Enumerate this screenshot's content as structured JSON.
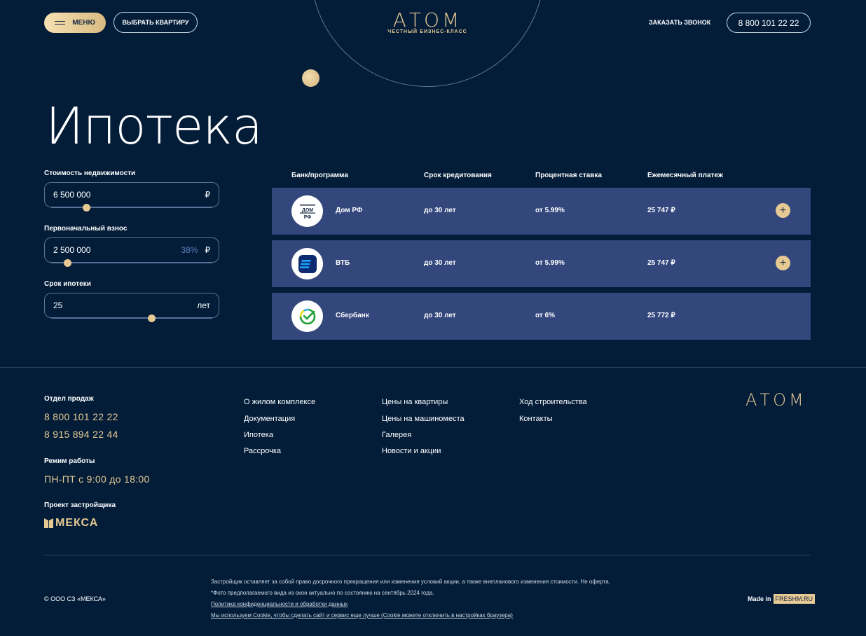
{
  "header": {
    "menu_label": "МЕНЮ",
    "choose_flat_label": "ВЫБРАТЬ КВАРТИРУ",
    "logo": "АТОМ",
    "logo_tagline": "ЧЕСТНЫЙ БИЗНЕС-КЛАСС",
    "call_label": "ЗАКАЗАТЬ ЗВОНОК",
    "phone": "8 800 101 22 22"
  },
  "page_title": "Ипотека",
  "calculator": {
    "price": {
      "label": "Стоимость недвижимости",
      "value": "6 500 000",
      "unit": "₽"
    },
    "down_payment": {
      "label": "Первоначальный взнос",
      "value": "2 500 000",
      "percent": "38%",
      "unit": "₽"
    },
    "term": {
      "label": "Срок ипотеки",
      "value": "25",
      "unit": "лет"
    }
  },
  "table": {
    "headers": [
      "Банк/программа",
      "Срок кредитования",
      "Процентная ставка",
      "Ежемесячный платеж"
    ],
    "rows": [
      {
        "bank": "Дом РФ",
        "logo_text": "ДОМ РФ",
        "term": "до 30 лет",
        "rate": "от 5.99%",
        "payment": "25 747 ₽",
        "expand": "+"
      },
      {
        "bank": "ВТБ",
        "term": "до 30 лет",
        "rate": "от 5.99%",
        "payment": "25 747 ₽",
        "expand": "+"
      },
      {
        "bank": "Сбербанк",
        "term": "до 30 лет",
        "rate": "от 6%",
        "payment": "25 772 ₽"
      }
    ]
  },
  "footer": {
    "sales_label": "Отдел продаж",
    "phones": [
      "8 800 101 22 22",
      "8 915 894 22 44"
    ],
    "hours_label": "Режим работы",
    "hours": "ПН-ПТ с 9:00 до 18:00",
    "developer_label": "Проект застройщика",
    "developer": "МЕКСА",
    "logo": "АТОМ",
    "nav_col1": [
      "О жилом комплексе",
      "Документация",
      "Ипотека",
      "Рассрочка"
    ],
    "nav_col2": [
      "Цены на квартиры",
      "Цены на машиноместа",
      "Галерея",
      "Новости и акции"
    ],
    "nav_col3": [
      "Ход строительства",
      "Контакты"
    ],
    "copyright": "© ООО СЗ «МЕКСА»",
    "disclaimer1": "Застройщик оставляет за собой право досрочного прекращения или изменения условий акции, а также внепланового изменения стоимости. Не оферта.",
    "disclaimer2": "*Фото предполагаемого вида из окон актуально по состоянию на сентябрь 2024 года.",
    "privacy_link": "Политика конфиденциальности и обработки данных",
    "cookie_link": "Мы используем Cookie, чтобы сделать сайт и сервис еще лучше (Cookie можете отключить в настройках браузера)",
    "made_in": "Made in",
    "made_in_brand": "FRESHM.RU"
  }
}
